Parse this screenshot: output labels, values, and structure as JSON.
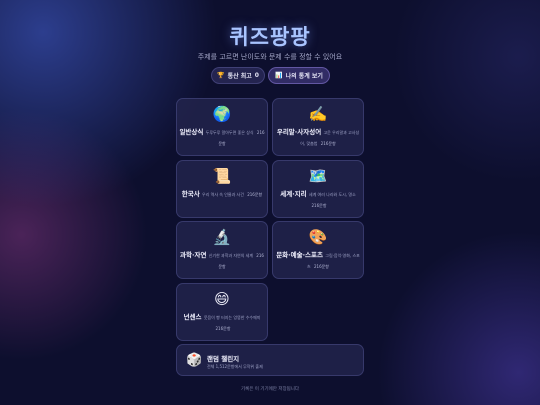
{
  "header": {
    "title": "퀴즈팡팡",
    "subtitle": "주제를 고르면 난이도와 문제 수를 정할 수 있어요"
  },
  "actions": {
    "best_icon": "🏆",
    "best_label": "통산 최고",
    "best_value": "0",
    "stats_icon": "📊",
    "stats_label": "나의 통계 보기"
  },
  "categories": [
    {
      "icon": "🌍",
      "name": "일반상식",
      "desc": "두루두루 알아두면 좋은 상식",
      "count": "216문항"
    },
    {
      "icon": "✍️",
      "name": "우리말·사자성어",
      "desc": "고운 우리말과 고사성어, 맞춤법",
      "count": "216문항"
    },
    {
      "icon": "📜",
      "name": "한국사",
      "desc": "우리 역사 속 인물과 사건",
      "count": "216문항"
    },
    {
      "icon": "🗺️",
      "name": "세계·지리",
      "desc": "세계 여러 나라와 도시, 명소",
      "count": "216문항"
    },
    {
      "icon": "🔬",
      "name": "과학·자연",
      "desc": "신기한 과학과 자연의 세계",
      "count": "216문항"
    },
    {
      "icon": "🎨",
      "name": "문화·예술·스포츠",
      "desc": "그림·음악·영화, 스포츠",
      "count": "216문항"
    },
    {
      "icon": "😄",
      "name": "넌센스",
      "desc": "웃음이 빵 터지는 엉뚱한 수수께끼",
      "count": "216문항"
    }
  ],
  "random": {
    "icon": "🎲",
    "title": "랜덤 챌린지",
    "desc": "전체 1,512문항에서 무작위 출제"
  },
  "footer": {
    "text": "기록은 이 기기에만 저장됩니다"
  }
}
